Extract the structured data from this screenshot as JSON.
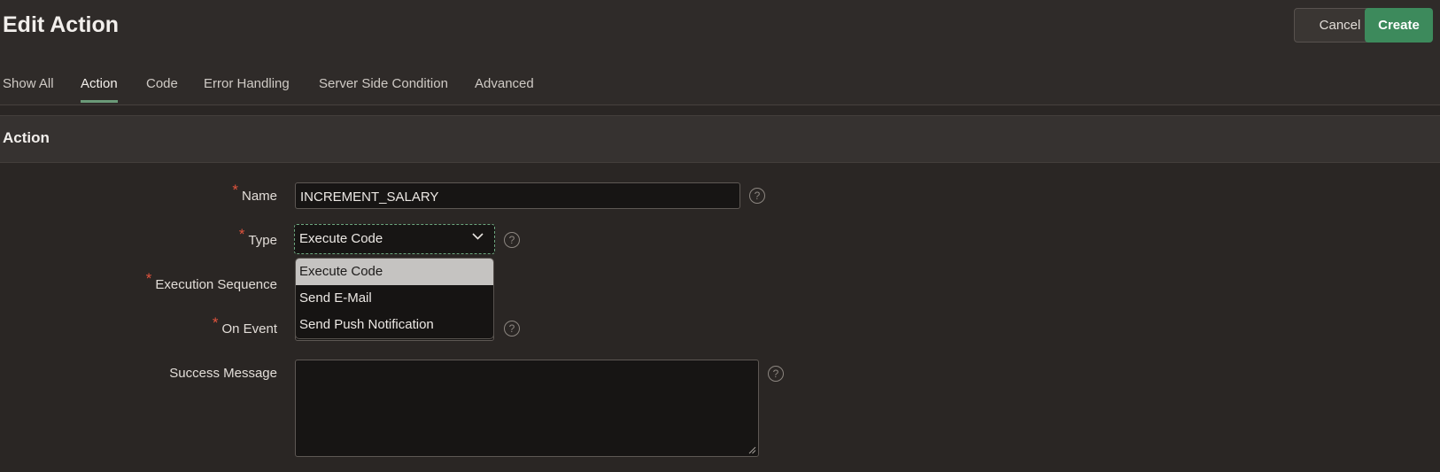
{
  "header": {
    "title": "Edit Action",
    "cancel_label": "Cancel",
    "create_label": "Create"
  },
  "tabs": [
    {
      "label": "Show All"
    },
    {
      "label": "Action",
      "active": true
    },
    {
      "label": "Code"
    },
    {
      "label": "Error Handling"
    },
    {
      "label": "Server Side Condition"
    },
    {
      "label": "Advanced"
    }
  ],
  "section": {
    "title": "Action"
  },
  "form": {
    "required_marker": "*",
    "help_glyph": "?",
    "name": {
      "label": "Name",
      "value": "INCREMENT_SALARY"
    },
    "type": {
      "label": "Type",
      "value": "Execute Code"
    },
    "execution_sequence": {
      "label": "Execution Sequence"
    },
    "on_event": {
      "label": "On Event"
    },
    "success_message": {
      "label": "Success Message",
      "value": ""
    }
  },
  "type_dropdown": {
    "options": [
      "Execute Code",
      "Send E-Mail",
      "Send Push Notification"
    ],
    "highlighted": "Execute Code"
  },
  "colors": {
    "background": "#2a2624",
    "accent_green": "#3d8a5c",
    "required_red": "#e0533d",
    "active_tab_underline": "#6b9a78"
  },
  "icons": [
    "chevron-down-icon",
    "help-icon",
    "resize-handle-icon"
  ]
}
